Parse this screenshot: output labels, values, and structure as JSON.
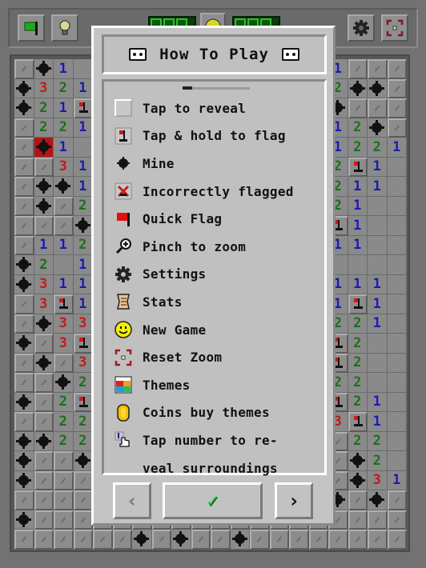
{
  "toolbar": {
    "left_buttons": [
      {
        "icon": "flag-icon"
      },
      {
        "icon": "hint-bulb-icon"
      }
    ],
    "mine_counter": "888",
    "timer": "888",
    "right_buttons": [
      {
        "icon": "gear-icon"
      },
      {
        "icon": "reset-zoom-icon"
      }
    ]
  },
  "dialog": {
    "title": "How To Play",
    "items": [
      {
        "icon": "unrevealed-tile-icon",
        "label": "Tap to reveal"
      },
      {
        "icon": "flag-tile-icon",
        "label": "Tap & hold to flag"
      },
      {
        "icon": "mine-icon",
        "label": "Mine"
      },
      {
        "icon": "incorrect-flag-icon",
        "label": "Incorrectly flagged"
      },
      {
        "icon": "quick-flag-icon",
        "label": "Quick Flag"
      },
      {
        "icon": "magnifier-icon",
        "label": "Pinch to zoom"
      },
      {
        "icon": "gear-icon",
        "label": "Settings"
      },
      {
        "icon": "scroll-icon",
        "label": "Stats"
      },
      {
        "icon": "smiley-icon",
        "label": "New Game"
      },
      {
        "icon": "reset-zoom-icon",
        "label": "Reset Zoom"
      },
      {
        "icon": "themes-icon",
        "label": "Themes"
      },
      {
        "icon": "coin-icon",
        "label": "Coins buy themes"
      },
      {
        "icon": "tap-number-icon",
        "label": "Tap number to re-"
      },
      {
        "icon": "",
        "label": "veal surroundings"
      }
    ],
    "buttons": {
      "prev": "‹",
      "ok": "✓",
      "next": "›"
    },
    "colors": {
      "accent_check": "#22cc44",
      "flag": "#d01818",
      "mine_hit": "#b31515"
    }
  },
  "board": {
    "cols": 20,
    "rows": 25,
    "legend": {
      "c": "covered",
      "e": "empty",
      "m": "mine",
      "X": "exploded-mine",
      "f": "flag",
      "1": "1",
      "2": "2",
      "3": "3"
    },
    "left": [
      "cm1e",
      "m321",
      "m21f",
      "c221",
      "cX1e",
      "cc31",
      "cmm1",
      "cmc2",
      "cccm",
      "c112",
      "m2e1",
      "m311",
      "c3f1",
      "cm33",
      "mc3f",
      "cmc3",
      "ccm2",
      "mc2f",
      "cc22",
      "mm22",
      "mccm",
      "mccc",
      "cccc",
      "mccc",
      "cccc"
    ],
    "right": [
      "1ccc",
      "2mmc",
      "mccc",
      "12mc",
      "1221",
      "2f1e",
      "211e",
      "21ee",
      "f1ee",
      "11ee",
      "eeee",
      "111e",
      "1f1e",
      "221e",
      "f2ee",
      "f2ee",
      "22ee",
      "f21e",
      "3f1e",
      "c22e",
      "cm2e",
      "cm31",
      "mcmc",
      "cccc",
      "cccc"
    ],
    "bottom_row": "ccccccmcmccmcccccccc"
  }
}
